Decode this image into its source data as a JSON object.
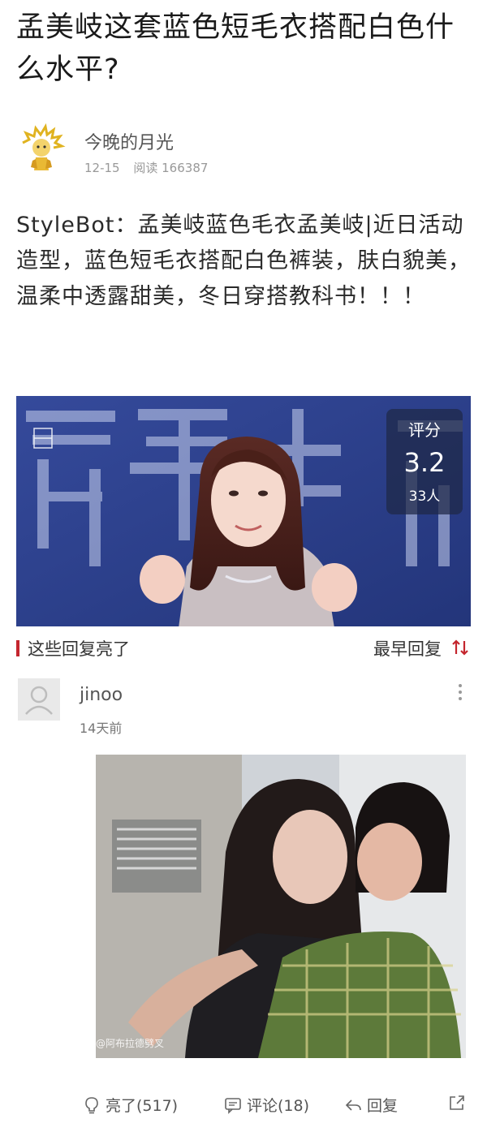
{
  "post": {
    "title": "孟美岐这套蓝色短毛衣搭配白色什么水平?",
    "author": "今晚的月光",
    "date": "12-15",
    "reads": "阅读 166387",
    "body": "StyleBot：孟美岐蓝色毛衣孟美岐|近日活动造型，蓝色短毛衣搭配白色裤装，肤白貌美，温柔中透露甜美，冬日穿搭教科书！！！",
    "rating": {
      "label": "评分",
      "score": "3.2",
      "count": "33人"
    }
  },
  "replies_section": {
    "label": "这些回复亮了",
    "sort_label": "最早回复"
  },
  "comment": {
    "author": "jinoo",
    "time": "14天前",
    "image_caption": "@阿布拉德劈叉"
  },
  "actions": {
    "like": "亮了(517)",
    "comment": "评论(18)",
    "reply": "回复"
  },
  "colors": {
    "accent": "#c4262e",
    "stage_blue": "#2c3f8c"
  }
}
